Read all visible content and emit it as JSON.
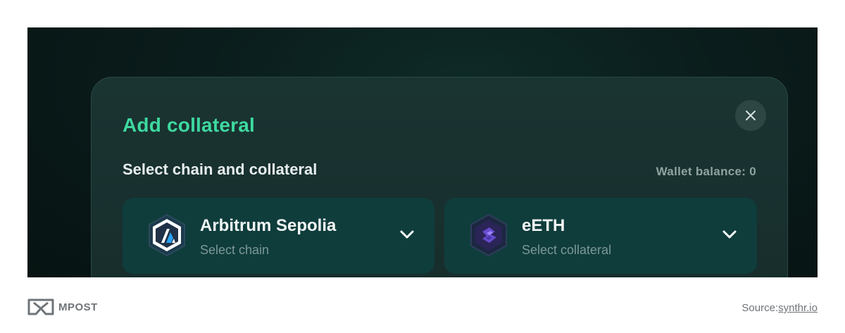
{
  "modal": {
    "title": "Add collateral",
    "section_label": "Select chain and collateral",
    "wallet_balance": "Wallet balance: 0",
    "close_symbol": "✕"
  },
  "chain_selector": {
    "name": "Arbitrum Sepolia",
    "sub": "Select chain",
    "icon": "arbitrum-icon"
  },
  "collateral_selector": {
    "name": "eETH",
    "sub": "Select collateral",
    "icon": "eeth-icon"
  },
  "footer": {
    "brand": "MPOST",
    "source_prefix": "Source:",
    "source_link": "synthr.io"
  },
  "colors": {
    "accent": "#3ed9a0",
    "modal_bg": "#172d2c",
    "selector_bg": "#0f3d3c",
    "backdrop": "#0a1c1b"
  }
}
